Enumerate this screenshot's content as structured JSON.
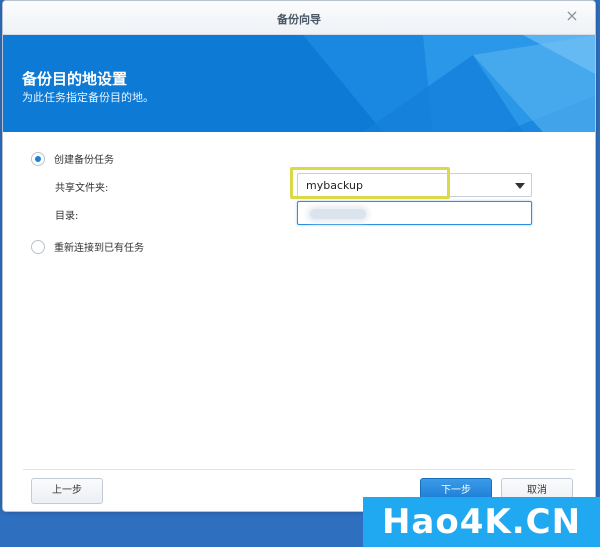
{
  "dialog": {
    "title": "备份向导",
    "close_icon": "close-icon",
    "close_glyph": "×"
  },
  "banner": {
    "heading": "备份目的地设置",
    "subheading": "为此任务指定备份目的地。",
    "color": "#0d7ad6"
  },
  "form": {
    "option_create": "创建备份任务",
    "option_create_checked": true,
    "shared_folder_label": "共享文件夹:",
    "shared_folder_value": "mybackup",
    "directory_label": "目录:",
    "option_reconnect": "重新连接到已有任务",
    "option_reconnect_checked": false
  },
  "footer": {
    "prev_label": "上一步",
    "next_label": "下一步",
    "cancel_label": "取消"
  },
  "watermark": {
    "text": "Hao4K.CN"
  },
  "colors": {
    "accent": "#1c7fd8",
    "highlight": "#d9d94a",
    "watermark": "#20a8f0"
  }
}
